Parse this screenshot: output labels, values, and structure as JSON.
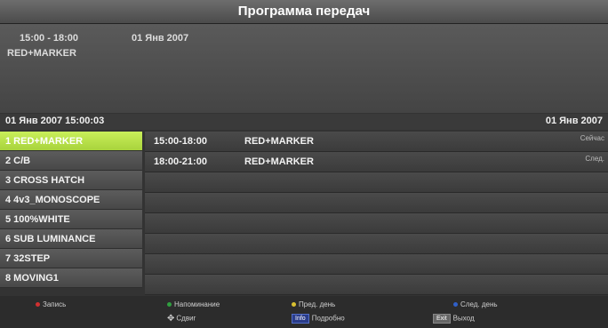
{
  "header": {
    "title": "Программа передач"
  },
  "info": {
    "time_range": "15:00 - 18:00",
    "date": "01 Янв 2007",
    "program": "RED+MARKER"
  },
  "datebar": {
    "current": "01 Янв 2007 15:00:03",
    "right_date": "01 Янв 2007"
  },
  "channels": [
    "1 RED+MARKER",
    "2 C/B",
    "3 CROSS HATCH",
    "4 4v3_MONOSCOPE",
    "5 100%WHITE",
    "6 SUB LUMINANCE",
    "7 32STEP",
    "8 MOVING1"
  ],
  "schedule": [
    {
      "time": "15:00-18:00",
      "title": "RED+MARKER",
      "day": "Сейчас"
    },
    {
      "time": "18:00-21:00",
      "title": "RED+MARKER",
      "day": "След."
    }
  ],
  "footer": {
    "record": "Запись",
    "reminder": "Напоминание",
    "prev_day": "Пред. день",
    "next_day": "След. день",
    "shift": "Сдвиг",
    "info_badge": "Info",
    "details": "Подробно",
    "exit_badge": "Exit",
    "exit": "Выход"
  },
  "colors": {
    "selected": "#b8e04a",
    "record_dot": "#d03030",
    "reminder_dot": "#30a040",
    "prev_dot": "#d8c030",
    "next_dot": "#3060c8"
  }
}
